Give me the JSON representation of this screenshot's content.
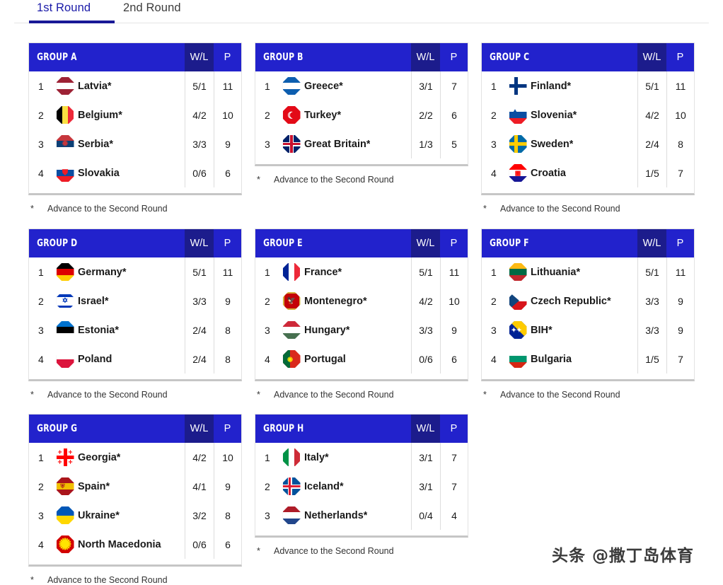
{
  "tabs": [
    {
      "label": "1st Round",
      "active": true
    },
    {
      "label": "2nd Round",
      "active": false
    }
  ],
  "columns": {
    "wl": "W/L",
    "p": "P"
  },
  "footnote": {
    "star": "*",
    "text": "Advance to the Second Round"
  },
  "watermark": "头条 @撒丁岛体育",
  "colors": {
    "header_blue": "#2222cc",
    "header_wl_blue": "#1c1c8c",
    "tab_active": "#191996",
    "tab_inactive": "#3c3c3c",
    "card_border": "#e2e2e2"
  },
  "groups": [
    {
      "name": "GROUP A",
      "rows": [
        {
          "rank": "1",
          "team": "Latvia*",
          "flag": "latvia",
          "wl": "5/1",
          "p": "11"
        },
        {
          "rank": "2",
          "team": "Belgium*",
          "flag": "belgium",
          "wl": "4/2",
          "p": "10"
        },
        {
          "rank": "3",
          "team": "Serbia*",
          "flag": "serbia",
          "wl": "3/3",
          "p": "9"
        },
        {
          "rank": "4",
          "team": "Slovakia",
          "flag": "slovakia",
          "wl": "0/6",
          "p": "6"
        }
      ]
    },
    {
      "name": "GROUP B",
      "rows": [
        {
          "rank": "1",
          "team": "Greece*",
          "flag": "greece",
          "wl": "3/1",
          "p": "7"
        },
        {
          "rank": "2",
          "team": "Turkey*",
          "flag": "turkey",
          "wl": "2/2",
          "p": "6"
        },
        {
          "rank": "3",
          "team": "Great Britain*",
          "flag": "great-britain",
          "wl": "1/3",
          "p": "5"
        }
      ]
    },
    {
      "name": "GROUP C",
      "rows": [
        {
          "rank": "1",
          "team": "Finland*",
          "flag": "finland",
          "wl": "5/1",
          "p": "11"
        },
        {
          "rank": "2",
          "team": "Slovenia*",
          "flag": "slovenia",
          "wl": "4/2",
          "p": "10"
        },
        {
          "rank": "3",
          "team": "Sweden*",
          "flag": "sweden",
          "wl": "2/4",
          "p": "8"
        },
        {
          "rank": "4",
          "team": "Croatia",
          "flag": "croatia",
          "wl": "1/5",
          "p": "7"
        }
      ]
    },
    {
      "name": "GROUP D",
      "rows": [
        {
          "rank": "1",
          "team": "Germany*",
          "flag": "germany",
          "wl": "5/1",
          "p": "11"
        },
        {
          "rank": "2",
          "team": "Israel*",
          "flag": "israel",
          "wl": "3/3",
          "p": "9"
        },
        {
          "rank": "3",
          "team": "Estonia*",
          "flag": "estonia",
          "wl": "2/4",
          "p": "8"
        },
        {
          "rank": "4",
          "team": "Poland",
          "flag": "poland",
          "wl": "2/4",
          "p": "8"
        }
      ]
    },
    {
      "name": "GROUP E",
      "rows": [
        {
          "rank": "1",
          "team": "France*",
          "flag": "france",
          "wl": "5/1",
          "p": "11"
        },
        {
          "rank": "2",
          "team": "Montenegro*",
          "flag": "montenegro",
          "wl": "4/2",
          "p": "10"
        },
        {
          "rank": "3",
          "team": "Hungary*",
          "flag": "hungary",
          "wl": "3/3",
          "p": "9"
        },
        {
          "rank": "4",
          "team": "Portugal",
          "flag": "portugal",
          "wl": "0/6",
          "p": "6"
        }
      ]
    },
    {
      "name": "GROUP F",
      "rows": [
        {
          "rank": "1",
          "team": "Lithuania*",
          "flag": "lithuania",
          "wl": "5/1",
          "p": "11"
        },
        {
          "rank": "2",
          "team": "Czech Republic*",
          "flag": "czech-republic",
          "wl": "3/3",
          "p": "9"
        },
        {
          "rank": "3",
          "team": "BIH*",
          "flag": "bih",
          "wl": "3/3",
          "p": "9"
        },
        {
          "rank": "4",
          "team": "Bulgaria",
          "flag": "bulgaria",
          "wl": "1/5",
          "p": "7"
        }
      ]
    },
    {
      "name": "GROUP G",
      "rows": [
        {
          "rank": "1",
          "team": "Georgia*",
          "flag": "georgia",
          "wl": "4/2",
          "p": "10"
        },
        {
          "rank": "2",
          "team": "Spain*",
          "flag": "spain",
          "wl": "4/1",
          "p": "9"
        },
        {
          "rank": "3",
          "team": "Ukraine*",
          "flag": "ukraine",
          "wl": "3/2",
          "p": "8"
        },
        {
          "rank": "4",
          "team": "North Macedonia",
          "flag": "north-macedonia",
          "wl": "0/6",
          "p": "6"
        }
      ]
    },
    {
      "name": "GROUP H",
      "rows": [
        {
          "rank": "1",
          "team": "Italy*",
          "flag": "italy",
          "wl": "3/1",
          "p": "7"
        },
        {
          "rank": "2",
          "team": "Iceland*",
          "flag": "iceland",
          "wl": "3/1",
          "p": "7"
        },
        {
          "rank": "3",
          "team": "Netherlands*",
          "flag": "netherlands",
          "wl": "0/4",
          "p": "4"
        }
      ]
    }
  ]
}
